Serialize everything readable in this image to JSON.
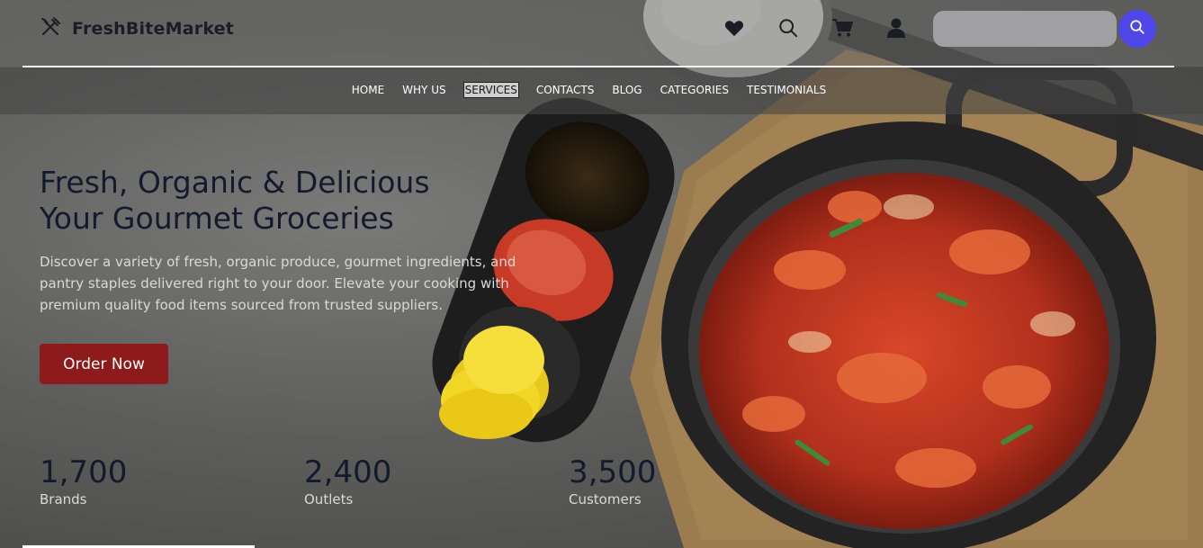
{
  "header": {
    "brand_name": "FreshBiteMarket",
    "brand_icon": "utensils-icon",
    "icons": [
      "heart-icon",
      "search-icon",
      "cart-icon",
      "user-icon"
    ],
    "search": {
      "placeholder": "",
      "value": "",
      "button_icon": "search-icon"
    }
  },
  "nav": {
    "items": [
      {
        "label": "HOME",
        "active": false
      },
      {
        "label": "WHY US",
        "active": false
      },
      {
        "label": "SERVICES",
        "active": true
      },
      {
        "label": "CONTACTS",
        "active": false
      },
      {
        "label": "BLOG",
        "active": false
      },
      {
        "label": "CATEGORIES",
        "active": false
      },
      {
        "label": "TESTIMONIALS",
        "active": false
      }
    ]
  },
  "hero": {
    "title_line1": "Fresh, Organic & Delicious",
    "title_line2": "Your Gourmet Groceries",
    "description": "Discover a variety of fresh, organic produce, gourmet ingredients, and pantry staples delivered right to your door. Elevate your cooking with premium quality food items sourced from trusted suppliers.",
    "cta_label": "Order Now"
  },
  "stats": [
    {
      "value": "1,700",
      "label": "Brands"
    },
    {
      "value": "2,400",
      "label": "Outlets"
    },
    {
      "value": "3,500",
      "label": "Customers"
    }
  ],
  "colors": {
    "accent": "#4f47e8",
    "cta": "#8e1b1b",
    "heading": "#141a2e"
  }
}
